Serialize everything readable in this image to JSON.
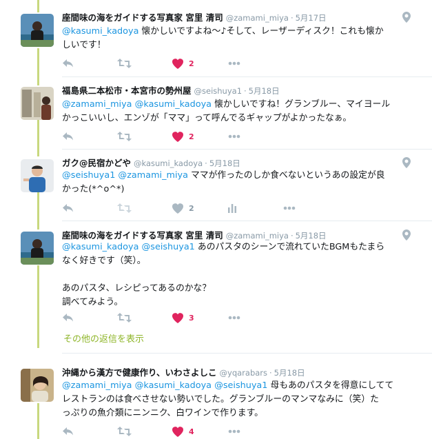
{
  "tweets": [
    {
      "name": "座間味の海をガイドする写真家 宮里 清司",
      "handle": "@zamami_miya",
      "date": "5月17日",
      "has_location": true,
      "lines": [
        [
          {
            "t": "@kasumi_kadoya",
            "m": true
          },
          {
            "t": " 懐かしいですよね〜♪そして、レーザーディスク！これも懐か"
          }
        ],
        [
          {
            "t": "しいです！"
          }
        ]
      ],
      "likes": "2",
      "liked": true,
      "retweets": "",
      "analytics": false
    },
    {
      "name": "福島県二本松市・本宮市の勢州屋",
      "handle": "@seishuya1",
      "date": "5月18日",
      "has_location": false,
      "lines": [
        [
          {
            "t": "@zamami_miya @kasumi_kadoya",
            "m": true
          },
          {
            "t": " 懐かしいですね！グランブルー、マイヨール"
          }
        ],
        [
          {
            "t": "かっこいいし、エンゾが「ママ」って呼んでるギャップがよかったなぁ。"
          }
        ]
      ],
      "likes": "2",
      "liked": true,
      "retweets": "",
      "analytics": false
    },
    {
      "name": "ガク@民宿かどや",
      "handle": "@kasumi_kadoya",
      "date": "5月18日",
      "has_location": true,
      "lines": [
        [
          {
            "t": "@seishuya1 @zamami_miya",
            "m": true
          },
          {
            "t": " ママが作ったのしか食べないというあの設定が良"
          }
        ],
        [
          {
            "t": "かった(*^o^*)"
          }
        ]
      ],
      "likes": "2",
      "liked": false,
      "retweets": "",
      "analytics": true
    },
    {
      "name": "座間味の海をガイドする写真家 宮里 清司",
      "handle": "@zamami_miya",
      "date": "5月18日",
      "has_location": true,
      "lines": [
        [
          {
            "t": "@kasumi_kadoya @seishuya1",
            "m": true
          },
          {
            "t": " あのパスタのシーンで流れていたBGMもたまら"
          }
        ],
        [
          {
            "t": "なく好きです（笑）。"
          }
        ],
        [
          {
            "t": ""
          }
        ],
        [
          {
            "t": "あのパスタ、レシピってあるのかな？"
          }
        ],
        [
          {
            "t": "調べてみよう。"
          }
        ]
      ],
      "likes": "3",
      "liked": true,
      "retweets": "",
      "analytics": false
    },
    {
      "name": "沖縄から漢方で健康作り、いわさよしこ",
      "handle": "@yqarabars",
      "date": "5月18日",
      "has_location": false,
      "lines": [
        [
          {
            "t": "@zamami_miya @kasumi_kadoya @seishuya1",
            "m": true
          },
          {
            "t": " 母もあのパスタを得意にしてて"
          }
        ],
        [
          {
            "t": "レストランのは食べさせない勢いでした。グランブルーのマンマなみに（笑）た"
          }
        ],
        [
          {
            "t": "っぷりの魚介類にニンニク、白ワインで作ります。"
          }
        ]
      ],
      "likes": "4",
      "liked": true,
      "retweets": "",
      "analytics": false
    }
  ],
  "more_replies_label": "その他の返信を表示",
  "colors": {
    "mention": "#1b95e0",
    "like_active": "#e0245e",
    "icon_gray": "#aab8c2",
    "thread_line": "#c8d87e",
    "more_replies": "#8fb62a"
  },
  "icons": {
    "reply": "reply-icon",
    "retweet": "retweet-icon",
    "like": "heart-icon",
    "more": "more-icon",
    "location": "location-pin-icon",
    "analytics": "analytics-icon"
  }
}
